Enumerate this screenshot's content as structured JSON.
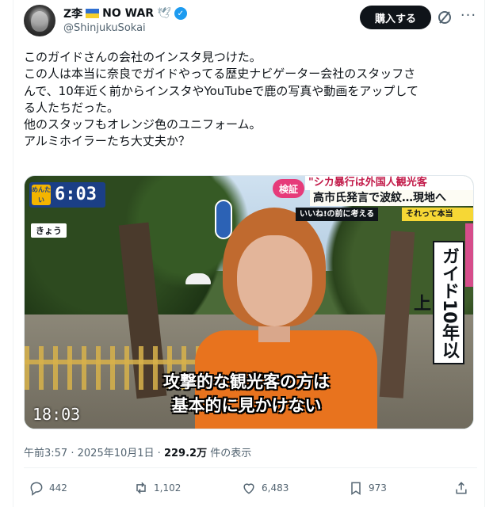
{
  "author": {
    "display_name": "Z李",
    "display_name_suffix": "NO WAR",
    "dove": "🕊",
    "verified_mark": "✓",
    "handle": "@ShinjukuSokai"
  },
  "header": {
    "buy_label": "購入する",
    "more_label": "···"
  },
  "tweet": {
    "lines": [
      "このガイドさんの会社のインスタ見つけた。",
      "この人は本当に奈良でガイドやってる歴史ナビゲーター会社のスタッフさ",
      "んで、10年近く前からインスタやYouTubeで鹿の写真や動画をアップして",
      "る人たちだった。",
      "他のスタッフもオレンジ色のユニフォーム。",
      "アルミホイラーたち大丈夫か？"
    ]
  },
  "media": {
    "badge_mini": "めんたい",
    "clock_main": "6:03",
    "kyo": "きょう",
    "clock_corner": "18:03",
    "kensho": "検証",
    "headline_top": "\"シカ暴行は外国人観光客",
    "headline_main": "高市氏発言で波紋…現地へ",
    "sub_left": "いいね!の前に考える",
    "sub_right": "それって本当",
    "vertical_caption": "ガイド10年以上",
    "subtitle_line1": "攻撃的な観光客の方は",
    "subtitle_line2": "基本的に見かけない"
  },
  "meta": {
    "time": "午前3:57",
    "sep1": "·",
    "date": "2025年10月1日",
    "sep2": "·",
    "views": "229.2万",
    "views_suffix": "件の表示"
  },
  "actions": {
    "replies": "442",
    "reposts": "1,102",
    "likes": "6,483",
    "bookmarks": "973"
  },
  "colors": {
    "accent_blue": "#1d9bf0",
    "text_primary": "#0f1419",
    "text_secondary": "#536471",
    "uniform_orange": "#e8731e"
  }
}
